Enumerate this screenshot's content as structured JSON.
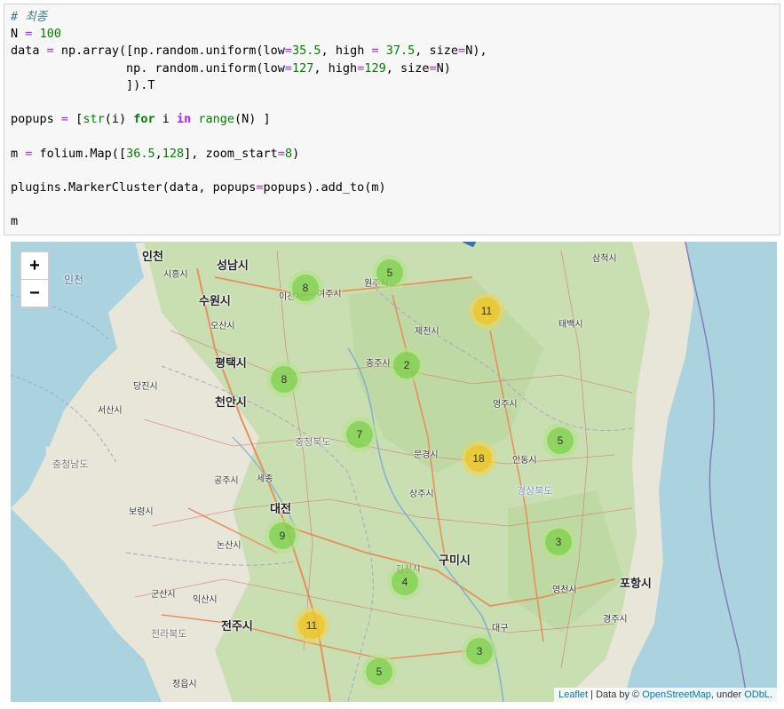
{
  "code_cell": {
    "line1": "# 최종",
    "n_name": "N",
    "n_value": "100",
    "fn_array": "np.array",
    "fn_uniform1": "np.random.uniform",
    "fn_uniform2": "np. random.uniform",
    "low1": "35.5",
    "high1": "37.5",
    "low2": "127",
    "high2": "129",
    "close_T": "]).T",
    "popups_line_a": "popups ",
    "popups_str": "str",
    "popups_i": "(i) ",
    "popups_for": "for",
    "popups_in": "in",
    "popups_range": "range",
    "popups_end": "(N) ]",
    "map_a": "m ",
    "map_fn": " folium.Map([",
    "map_lat": "36.5",
    "map_lon": "128",
    "map_zoom_key": "], zoom_start",
    "map_zoom": "8",
    "plugin_line": "plugins.MarkerCluster(data, popups",
    "plugin_end": "popups).add_to(m)",
    "last_line": "m"
  },
  "map": {
    "zoom_in": "+",
    "zoom_out": "−",
    "attribution": {
      "leaflet": "Leaflet",
      "sep1": " | Data by © ",
      "osm": "OpenStreetMap",
      "sep2": ", under ",
      "odbl": "ODbL",
      "end": "."
    },
    "clusters": [
      {
        "count": "5",
        "size": "small"
      },
      {
        "count": "8",
        "size": "small"
      },
      {
        "count": "11",
        "size": "medium"
      },
      {
        "count": "2",
        "size": "small"
      },
      {
        "count": "8",
        "size": "small"
      },
      {
        "count": "7",
        "size": "small"
      },
      {
        "count": "18",
        "size": "medium"
      },
      {
        "count": "5",
        "size": "small"
      },
      {
        "count": "9",
        "size": "small"
      },
      {
        "count": "3",
        "size": "small"
      },
      {
        "count": "4",
        "size": "small"
      },
      {
        "count": "11",
        "size": "medium"
      },
      {
        "count": "3",
        "size": "small"
      },
      {
        "count": "5",
        "size": "small"
      }
    ],
    "places": {
      "incheon": "인천",
      "incheon_en": "인천",
      "seongnam": "성남시",
      "siheung": "시흥시",
      "suwon": "수원시",
      "osan": "오산시",
      "icheon": "이천시",
      "yeoju": "여주시",
      "wonju": "원주시",
      "samcheok": "삼척시",
      "taebaek": "태백시",
      "jecheon": "제천시",
      "pyeongtaek": "평택시",
      "chungju": "충주시",
      "dangjin": "당진시",
      "seosan": "서산시",
      "cheonan": "천안시",
      "yeongju": "영주시",
      "chungbuk": "충청북도",
      "mungyeong": "문경시",
      "andong": "안동시",
      "chungnam": "충청남도",
      "gongju": "공주시",
      "sejong": "세종",
      "sangju": "상주시",
      "gyeongbuk": "경상북도",
      "daejeon": "대전",
      "boryeong": "보령시",
      "nonsan": "논산시",
      "gumi": "구미시",
      "gimcheon": "김천시",
      "yeongcheon": "영천시",
      "pohang": "포항시",
      "gunsan": "군산시",
      "iksan": "익산시",
      "jeonbuk": "전라북도",
      "jeonju": "전주시",
      "daegu": "대구",
      "gyeongju": "경주시",
      "jeongeup": "정읍시"
    }
  }
}
